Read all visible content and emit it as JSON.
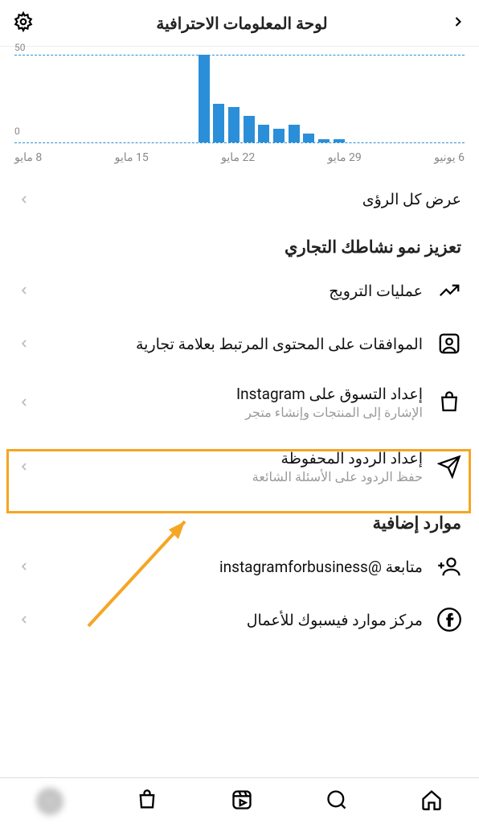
{
  "header": {
    "title": "لوحة المعلومات الاحترافية"
  },
  "chart_data": {
    "type": "bar",
    "ylabel": "",
    "ylim": [
      0,
      50
    ],
    "y_ticks": [
      "50",
      "0"
    ],
    "x_labels": [
      "6 يونيو",
      "29 مايو",
      "22 مايو",
      "15 مايو",
      "8 مايو"
    ],
    "values": [
      0,
      0,
      0,
      0,
      0,
      0,
      0,
      0,
      2,
      2,
      5,
      10,
      8,
      10,
      15,
      20,
      22,
      50,
      0,
      0,
      0,
      0,
      0,
      0,
      0,
      0,
      0,
      0,
      0,
      0
    ]
  },
  "insights_link": "عرض كل الرؤى",
  "grow_section_title": "تعزيز نمو نشاطك التجاري",
  "grow_items": [
    {
      "title": "عمليات الترويج",
      "sub": "",
      "icon": "trend"
    },
    {
      "title": "الموافقات على المحتوى المرتبط بعلامة تجارية",
      "sub": "",
      "icon": "profile-box"
    },
    {
      "title": "إعداد التسوق على Instagram",
      "sub": "الإشارة إلى المنتجات وإنشاء متجر",
      "icon": "shop"
    },
    {
      "title": "إعداد الردود المحفوظة",
      "sub": "حفظ الردود على الأسئلة الشائعة",
      "icon": "send"
    }
  ],
  "resources_title": "موارد إضافية",
  "resources": [
    {
      "title": "متابعة @instagramforbusiness",
      "icon": "follow"
    },
    {
      "title": "مركز موارد فيسبوك للأعمال",
      "icon": "facebook"
    }
  ]
}
